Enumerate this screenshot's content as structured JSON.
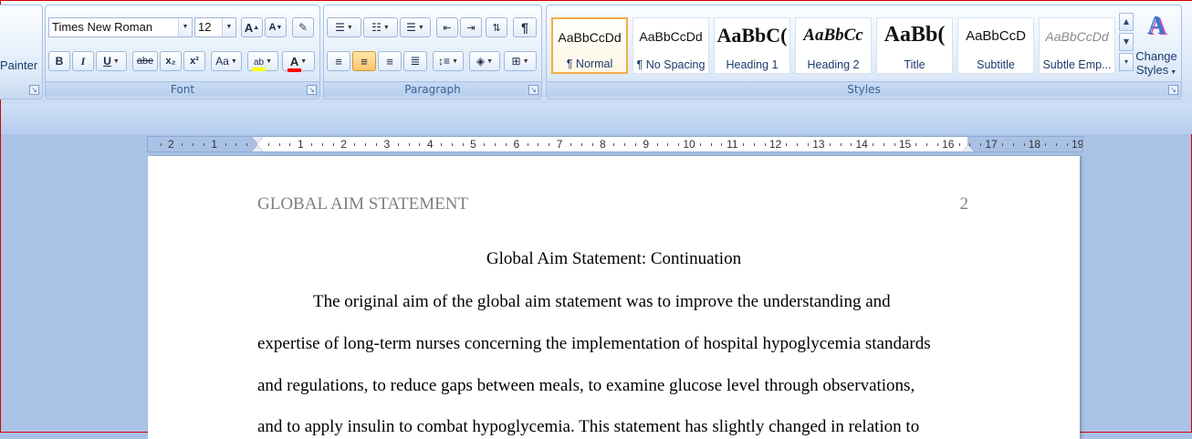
{
  "ribbon": {
    "clipboard": {
      "format_painter_label": "Painter"
    },
    "font": {
      "group_label": "Font",
      "font_name": "Times New Roman",
      "font_size": "12",
      "grow_font": "A",
      "shrink_font": "A",
      "bold": "B",
      "italic": "I",
      "underline": "U",
      "strikethrough": "abe",
      "subscript": "x₂",
      "superscript": "x²",
      "change_case": "Aa",
      "highlight": "ab",
      "font_color": "A"
    },
    "paragraph": {
      "group_label": "Paragraph"
    },
    "styles": {
      "group_label": "Styles",
      "items": [
        {
          "sample": "AaBbCcDd",
          "name": "¶ Normal"
        },
        {
          "sample": "AaBbCcDd",
          "name": "¶ No Spacing"
        },
        {
          "sample": "AaBbC(",
          "name": "Heading 1"
        },
        {
          "sample": "AaBbCc",
          "name": "Heading 2"
        },
        {
          "sample": "AaBb(",
          "name": "Title"
        },
        {
          "sample": "AaBbCcD",
          "name": "Subtitle"
        },
        {
          "sample": "AaBbCcDd",
          "name": "Subtle Emp..."
        }
      ],
      "change_styles_line1": "Change",
      "change_styles_line2": "Styles"
    }
  },
  "ruler": {
    "labels_left": [
      "2",
      "1"
    ],
    "labels_right": [
      "1",
      "2",
      "3",
      "4",
      "5",
      "6",
      "7",
      "8",
      "9",
      "10",
      "11",
      "12",
      "13",
      "14",
      "15",
      "16",
      "17",
      "18",
      "19"
    ]
  },
  "document": {
    "header_left": "GLOBAL AIM STATEMENT",
    "header_right": "2",
    "title": "Global Aim Statement: Continuation",
    "lines": [
      "The original aim of the global aim statement was to improve the understanding and",
      "expertise of long-term nurses concerning the implementation of hospital hypoglycemia standards",
      "and regulations, to reduce gaps between meals, to examine glucose level through observations,",
      "and to apply insulin to combat hypoglycemia. This statement has slightly changed in relation to"
    ]
  },
  "colors": {
    "ribbon_bg": "#dfeafa",
    "selected_style_border": "#f3ad44",
    "highlight_yellow": "#ffff00",
    "font_color_red": "#ff0000",
    "header_gray": "#7f7f7f"
  }
}
